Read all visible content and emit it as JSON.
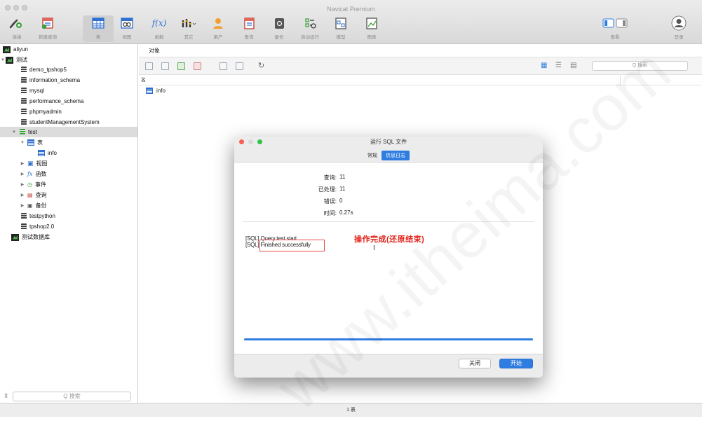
{
  "window": {
    "title": "Navicat Premium"
  },
  "toolbar": {
    "items": [
      {
        "label": "连接",
        "icon": "connection-icon"
      },
      {
        "label": "新建查询",
        "icon": "new-query-icon"
      },
      {
        "label": "表",
        "icon": "table-icon"
      },
      {
        "label": "视图",
        "icon": "view-icon"
      },
      {
        "label": "函数",
        "icon": "function-icon"
      },
      {
        "label": "其它",
        "icon": "other-icon"
      },
      {
        "label": "用户",
        "icon": "user-icon"
      },
      {
        "label": "查询",
        "icon": "query-icon"
      },
      {
        "label": "备份",
        "icon": "backup-icon"
      },
      {
        "label": "自动运行",
        "icon": "auto-run-icon"
      },
      {
        "label": "模型",
        "icon": "model-icon"
      },
      {
        "label": "图表",
        "icon": "chart-icon"
      }
    ],
    "view_label": "查看",
    "login_label": "登录",
    "function_glyph": "f(x)"
  },
  "sidebar": {
    "tree": [
      "aliyun",
      "测试",
      "demo_tpshop5",
      "information_schema",
      "mysql",
      "performance_schema",
      "phpmyadmin",
      "studentManagementSystem",
      "test",
      "表",
      "info",
      "视图",
      "函数",
      "事件",
      "查询",
      "备份",
      "testpython",
      "tpshop2.0",
      "测试数据库"
    ],
    "search_placeholder": "Q 搜索"
  },
  "main": {
    "objects_tab": "对象",
    "name_header": "名",
    "search_placeholder": "Q 搜索",
    "object_name": "info",
    "status": "1 表"
  },
  "dialog": {
    "title": "运行 SQL 文件",
    "tabs": [
      "常规",
      "信息日志"
    ],
    "stats": [
      {
        "label": "查询:",
        "value": "11"
      },
      {
        "label": "已处理:",
        "value": "11"
      },
      {
        "label": "错误:",
        "value": "0"
      },
      {
        "label": "时间:",
        "value": "0.27s"
      }
    ],
    "log": [
      "[SQL] Query test start",
      "[SQL] Finished successfully"
    ],
    "annotation": "操作完成(还原结束)",
    "progress": 1.0,
    "close_label": "关闭",
    "start_label": "开始"
  },
  "watermark": "www.itheima.com",
  "colors": {
    "accent": "#2f7de1",
    "annotation": "#e2231a",
    "green": "#3aa03a"
  }
}
